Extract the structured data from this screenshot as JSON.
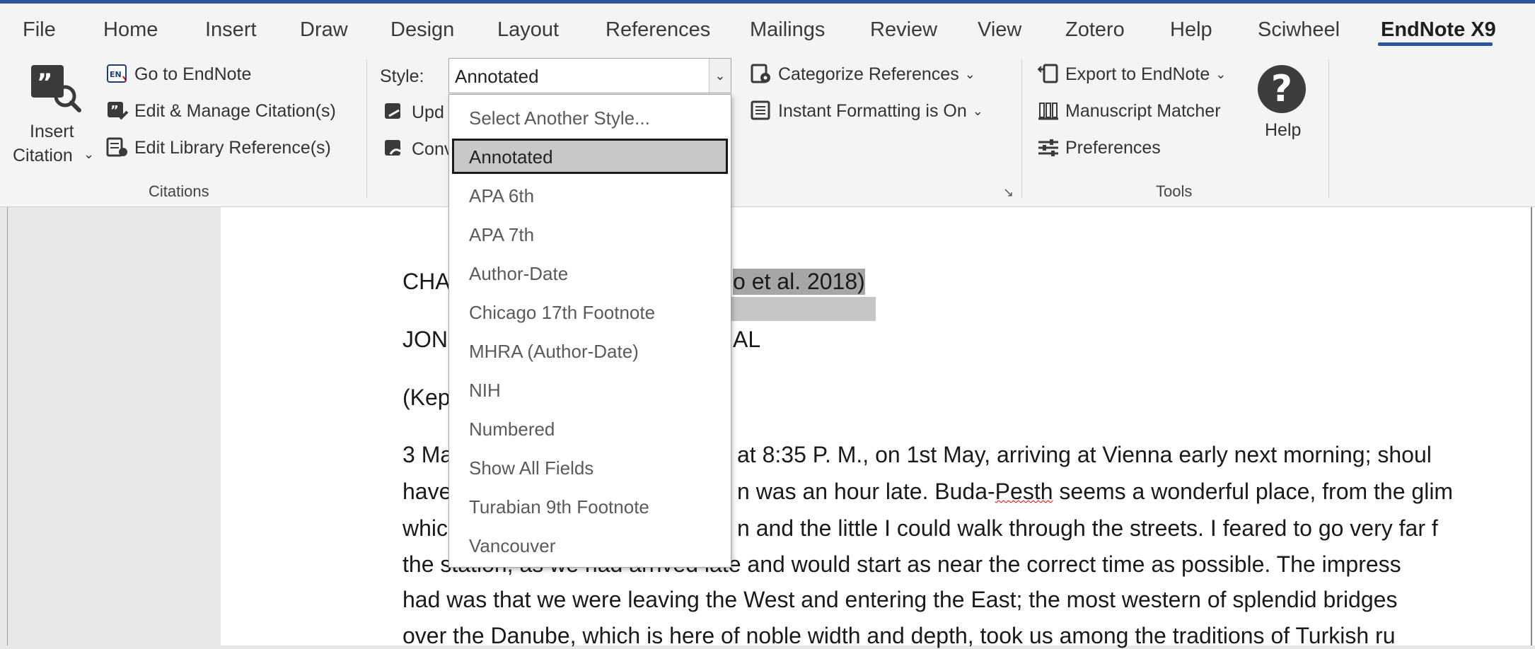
{
  "tabs": [
    "File",
    "Home",
    "Insert",
    "Draw",
    "Design",
    "Layout",
    "References",
    "Mailings",
    "Review",
    "View",
    "Zotero",
    "Help",
    "Sciwheel",
    "EndNote X9"
  ],
  "active_tab": "EndNote X9",
  "citations_group": {
    "insert_citation_line1": "Insert",
    "insert_citation_line2": "Citation",
    "go_to_endnote": "Go to EndNote",
    "edit_manage": "Edit & Manage Citation(s)",
    "edit_library": "Edit Library Reference(s)",
    "label": "Citations"
  },
  "bibliography_group": {
    "style_label": "Style:",
    "style_value": "Annotated",
    "update_partial": "Upd",
    "convert_partial": "Conv",
    "categorize": "Categorize References",
    "instant_formatting": "Instant Formatting is On"
  },
  "tools_group": {
    "export": "Export to EndNote",
    "manuscript_matcher": "Manuscript Matcher",
    "preferences": "Preferences",
    "help": "Help",
    "label": "Tools"
  },
  "style_dropdown": {
    "items": [
      "Select Another Style...",
      "Annotated",
      "APA 6th",
      "APA 7th",
      "Author-Date",
      "Chicago 17th Footnote",
      "MHRA (Author-Date)",
      "NIH",
      "Numbered",
      "Show All Fields",
      "Turabian 9th Footnote",
      "Vancouver"
    ],
    "selected": "Annotated"
  },
  "document": {
    "line1_left": "CHA",
    "line1_right": "o et al. 2018)",
    "line2_left": "JON",
    "line2_right": "AL",
    "line3_left": "(Kep",
    "p1_left": "3 Ma",
    "p1_right": "at 8:35 P. M., on 1st May, arriving at Vienna early next morning; shoul",
    "p2_left": "have",
    "p2_mid": "n was an hour late. Buda-",
    "p2_squig": "Pesth",
    "p2_right": " seems a wonderful place, from the glim",
    "p3_left": "whic",
    "p3_right": "n and the little I could walk through the streets. I feared to go very far f",
    "p4": "the station, as we had arrived late and would start as near the correct time as possible. The impress",
    "p5": "had was that we were leaving the West and entering the East; the most western of splendid bridges",
    "p6": "over the Danube, which is here of noble width and depth, took us among the traditions of Turkish ru"
  }
}
